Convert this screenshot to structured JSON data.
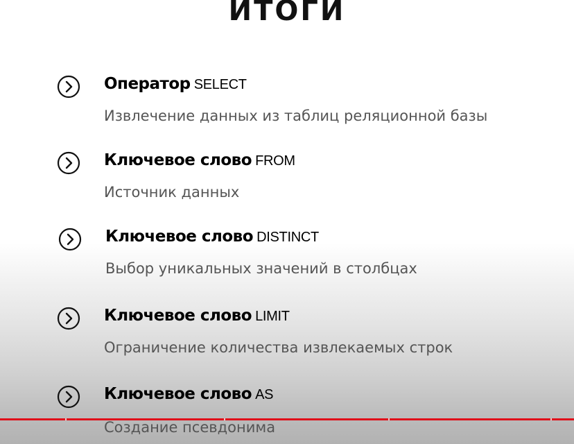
{
  "slide": {
    "title": "ИТОГИ"
  },
  "items": [
    {
      "lead": "Оператор",
      "keyword": "SELECT",
      "description": "Извлечение данных из таблиц реляционной базы"
    },
    {
      "lead": "Ключевое слово",
      "keyword": "FROM",
      "description": "Источник данных"
    },
    {
      "lead": "Ключевое слово",
      "keyword": "DISTINCT",
      "description": "Выбор уникальных значений в столбцах"
    },
    {
      "lead": "Ключевое слово",
      "keyword": "LIMIT",
      "description": "Ограничение количества извлекаемых строк"
    },
    {
      "lead": "Ключевое слово",
      "keyword": "AS",
      "description": "Создание псевдонима"
    }
  ],
  "icons": {
    "bullet": "chevron-right-circle-icon"
  },
  "colors": {
    "progress": "#e0101a",
    "heading_text": "#000000",
    "description_text": "#555555"
  }
}
